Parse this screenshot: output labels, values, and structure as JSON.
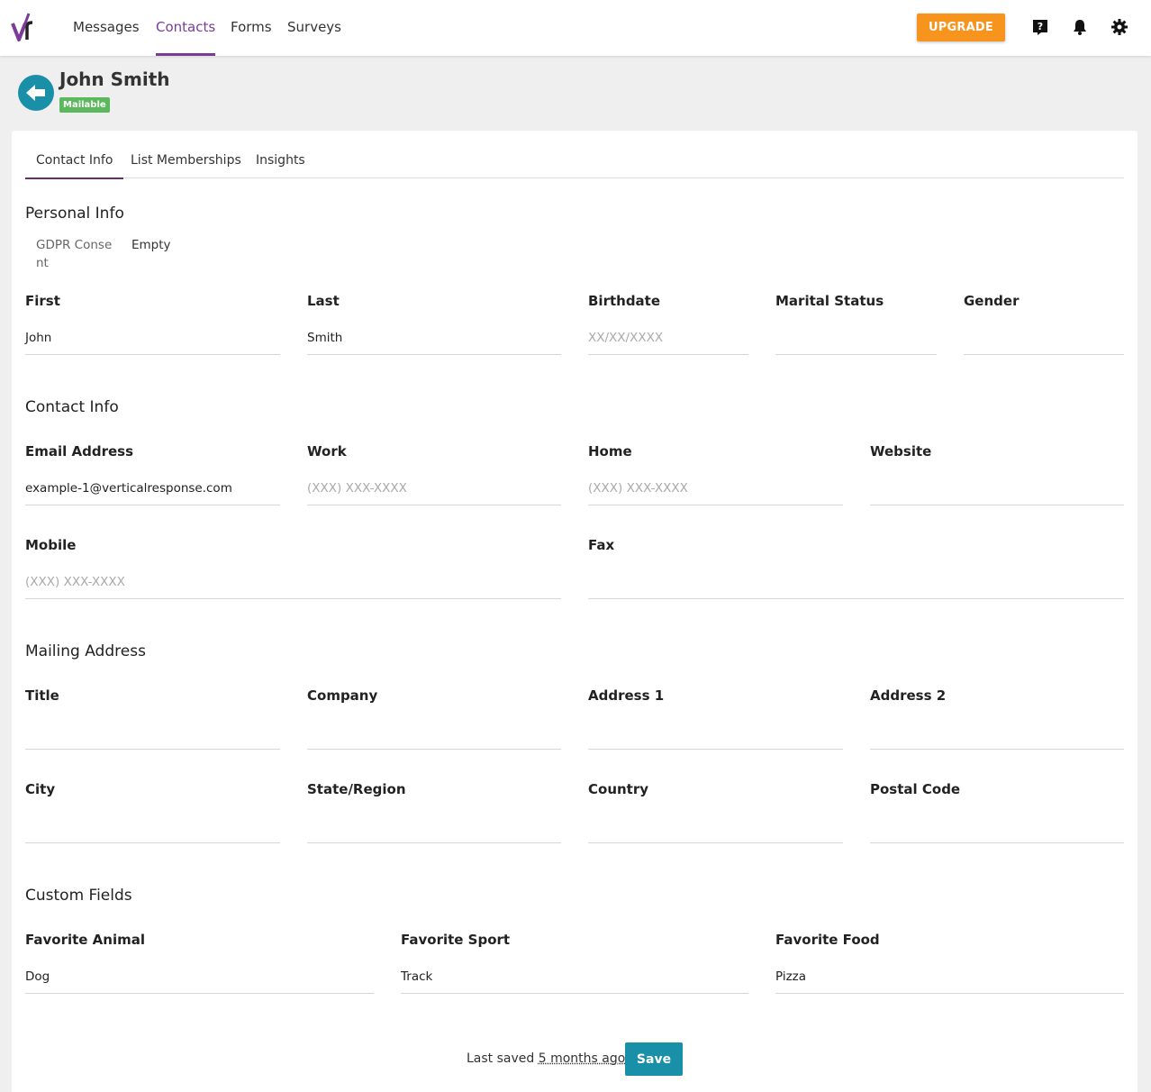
{
  "nav": {
    "items": [
      {
        "label": "Messages",
        "active": false
      },
      {
        "label": "Contacts",
        "active": true
      },
      {
        "label": "Forms",
        "active": false
      },
      {
        "label": "Surveys",
        "active": false
      }
    ],
    "upgrade_label": "UPGRADE",
    "icons": [
      "help-icon",
      "bell-icon",
      "gear-icon"
    ]
  },
  "contact": {
    "name": "John Smith",
    "status": "Mailable"
  },
  "tabs": [
    {
      "label": "Contact Info",
      "active": true
    },
    {
      "label": "List Memberships",
      "active": false
    },
    {
      "label": "Insights",
      "active": false
    }
  ],
  "personal": {
    "title": "Personal Info",
    "gdpr_label": "GDPR Consent",
    "gdpr_value": "Empty",
    "first_label": "First",
    "first_value": "John",
    "last_label": "Last",
    "last_value": "Smith",
    "birthdate_label": "Birthdate",
    "birthdate_placeholder": "XX/XX/XXXX",
    "marital_label": "Marital Status",
    "marital_value": "",
    "gender_label": "Gender",
    "gender_value": ""
  },
  "contact_info": {
    "title": "Contact Info",
    "email_label": "Email Address",
    "email_value": "example-1@verticalresponse.com",
    "work_label": "Work",
    "work_placeholder": "(XXX) XXX-XXXX",
    "home_label": "Home",
    "home_placeholder": "(XXX) XXX-XXXX",
    "website_label": "Website",
    "website_value": "",
    "mobile_label": "Mobile",
    "mobile_placeholder": "(XXX) XXX-XXXX",
    "fax_label": "Fax",
    "fax_value": ""
  },
  "mailing": {
    "title": "Mailing Address",
    "title_label": "Title",
    "company_label": "Company",
    "address1_label": "Address 1",
    "address2_label": "Address 2",
    "city_label": "City",
    "state_label": "State/Region",
    "country_label": "Country",
    "postal_label": "Postal Code"
  },
  "custom": {
    "title": "Custom Fields",
    "animal_label": "Favorite Animal",
    "animal_value": "Dog",
    "sport_label": "Favorite Sport",
    "sport_value": "Track",
    "food_label": "Favorite Food",
    "food_value": "Pizza"
  },
  "footer": {
    "last_saved_prefix": "Last saved",
    "last_saved_ago": "5 months ago",
    "save_label": "Save"
  },
  "colors": {
    "brand_purple": "#7b3b98",
    "upgrade_orange": "#f7941d",
    "teal": "#1a8fa8",
    "mailable_green": "#5cb85c"
  }
}
